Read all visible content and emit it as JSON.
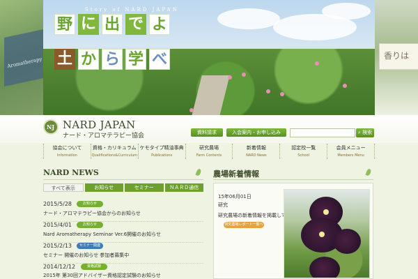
{
  "hero": {
    "tagline": "Story of NARD JAPAN",
    "tiles": [
      "野",
      "に",
      "出",
      "で",
      "よ",
      "土",
      "か",
      "ら",
      "学",
      "べ"
    ],
    "left_card_text": "Aromatherapy",
    "right_board_text": "香りは"
  },
  "header": {
    "logo_mark": "NJ",
    "brand_name": "NARD JAPAN",
    "brand_sub": "ナード・アロマテラピー協会",
    "buttons": [
      "資料請求",
      "入会案内・お申し込み"
    ],
    "search": {
      "placeholder": "",
      "button_label": "検索"
    }
  },
  "nav": [
    {
      "jp": "協会について",
      "en": "Information"
    },
    {
      "jp": "資格・カリキュラム",
      "en": "Qualifications&Curriculum"
    },
    {
      "jp": "ケモタイプ精油事典",
      "en": "Publications"
    },
    {
      "jp": "研究農場",
      "en": "Farm Contents"
    },
    {
      "jp": "新着情報",
      "en": "NARD News"
    },
    {
      "jp": "認定校一覧",
      "en": "School"
    },
    {
      "jp": "会員メニュー",
      "en": "Members Menu"
    }
  ],
  "news": {
    "title": "NARD NEWS",
    "tabs": [
      "すべて表示",
      "お知らせ",
      "セミナー",
      "ＮＡＲＤ通信"
    ],
    "items": [
      {
        "date": "2015/5/28",
        "badge": "お知らせ",
        "badge_color": "#76b033",
        "text": "ナード・アロマテラピー協会からのお知らせ"
      },
      {
        "date": "2015/4/01",
        "badge": "お知らせ",
        "badge_color": "#76b033",
        "text": "Nard Aromatherapy Seminar Ver.6開催のお知らせ"
      },
      {
        "date": "2015/2/13",
        "badge": "セミナー関連",
        "badge_color": "#3f7bb6",
        "text": "セミナー 開催のお知らせ 参加者募集中"
      },
      {
        "date": "2014/12/12",
        "badge": "資格試験",
        "badge_color": "#76b033",
        "text": "2015年 第30回アドバイザー資格認定試験のお知らせ"
      }
    ]
  },
  "farm": {
    "title": "農場新着情報",
    "date": "15年06月01日",
    "category": "研究",
    "text": "研究農場の新着情報を掲載しています",
    "more_label": "研究農場レポート一覧へ"
  }
}
